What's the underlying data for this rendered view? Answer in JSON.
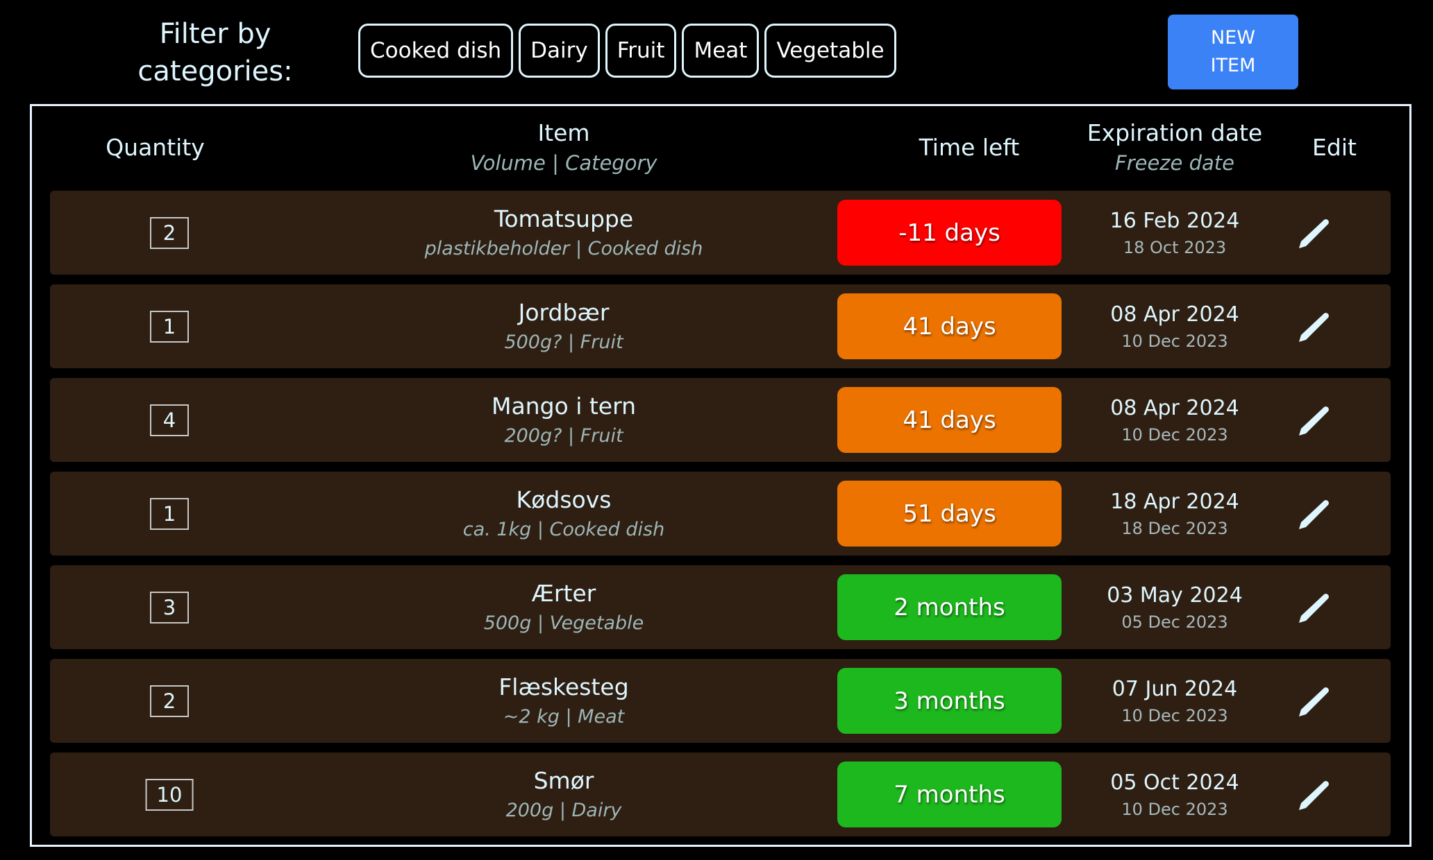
{
  "filter": {
    "label": "Filter by categories:",
    "categories": [
      "Cooked dish",
      "Dairy",
      "Fruit",
      "Meat",
      "Vegetable"
    ]
  },
  "new_item": {
    "line1": "NEW",
    "line2": "ITEM",
    "color": "#3b82f6"
  },
  "table": {
    "headers": {
      "quantity": "Quantity",
      "item": "Item",
      "item_sub": "Volume | Category",
      "time_left": "Time left",
      "expiration": "Expiration date",
      "expiration_sub": "Freeze date",
      "edit": "Edit"
    },
    "status_colors": {
      "expired": "#ff0000",
      "soon": "#ed7300",
      "ok": "#1db81d"
    },
    "rows": [
      {
        "quantity": "2",
        "name": "Tomatsuppe",
        "meta": "plastikbeholder | Cooked dish",
        "time_left": "-11 days",
        "status": "expired",
        "expiration": "16 Feb 2024",
        "freeze": "18 Oct 2023",
        "edit_icon": "pencil-icon"
      },
      {
        "quantity": "1",
        "name": "Jordbær",
        "meta": "500g? | Fruit",
        "time_left": "41 days",
        "status": "soon",
        "expiration": "08 Apr 2024",
        "freeze": "10 Dec 2023",
        "edit_icon": "pencil-icon"
      },
      {
        "quantity": "4",
        "name": "Mango i tern",
        "meta": "200g? | Fruit",
        "time_left": "41 days",
        "status": "soon",
        "expiration": "08 Apr 2024",
        "freeze": "10 Dec 2023",
        "edit_icon": "pencil-icon"
      },
      {
        "quantity": "1",
        "name": "Kødsovs",
        "meta": "ca. 1kg | Cooked dish",
        "time_left": "51 days",
        "status": "soon",
        "expiration": "18 Apr 2024",
        "freeze": "18 Dec 2023",
        "edit_icon": "pencil-icon"
      },
      {
        "quantity": "3",
        "name": "Ærter",
        "meta": "500g | Vegetable",
        "time_left": "2 months",
        "status": "ok",
        "expiration": "03 May 2024",
        "freeze": "05 Dec 2023",
        "edit_icon": "pencil-icon"
      },
      {
        "quantity": "2",
        "name": "Flæskesteg",
        "meta": "~2 kg | Meat",
        "time_left": "3 months",
        "status": "ok",
        "expiration": "07 Jun 2024",
        "freeze": "10 Dec 2023",
        "edit_icon": "pencil-icon"
      },
      {
        "quantity": "10",
        "name": "Smør",
        "meta": "200g | Dairy",
        "time_left": "7 months",
        "status": "ok",
        "expiration": "05 Oct 2024",
        "freeze": "10 Dec 2023",
        "edit_icon": "pencil-icon"
      }
    ]
  }
}
